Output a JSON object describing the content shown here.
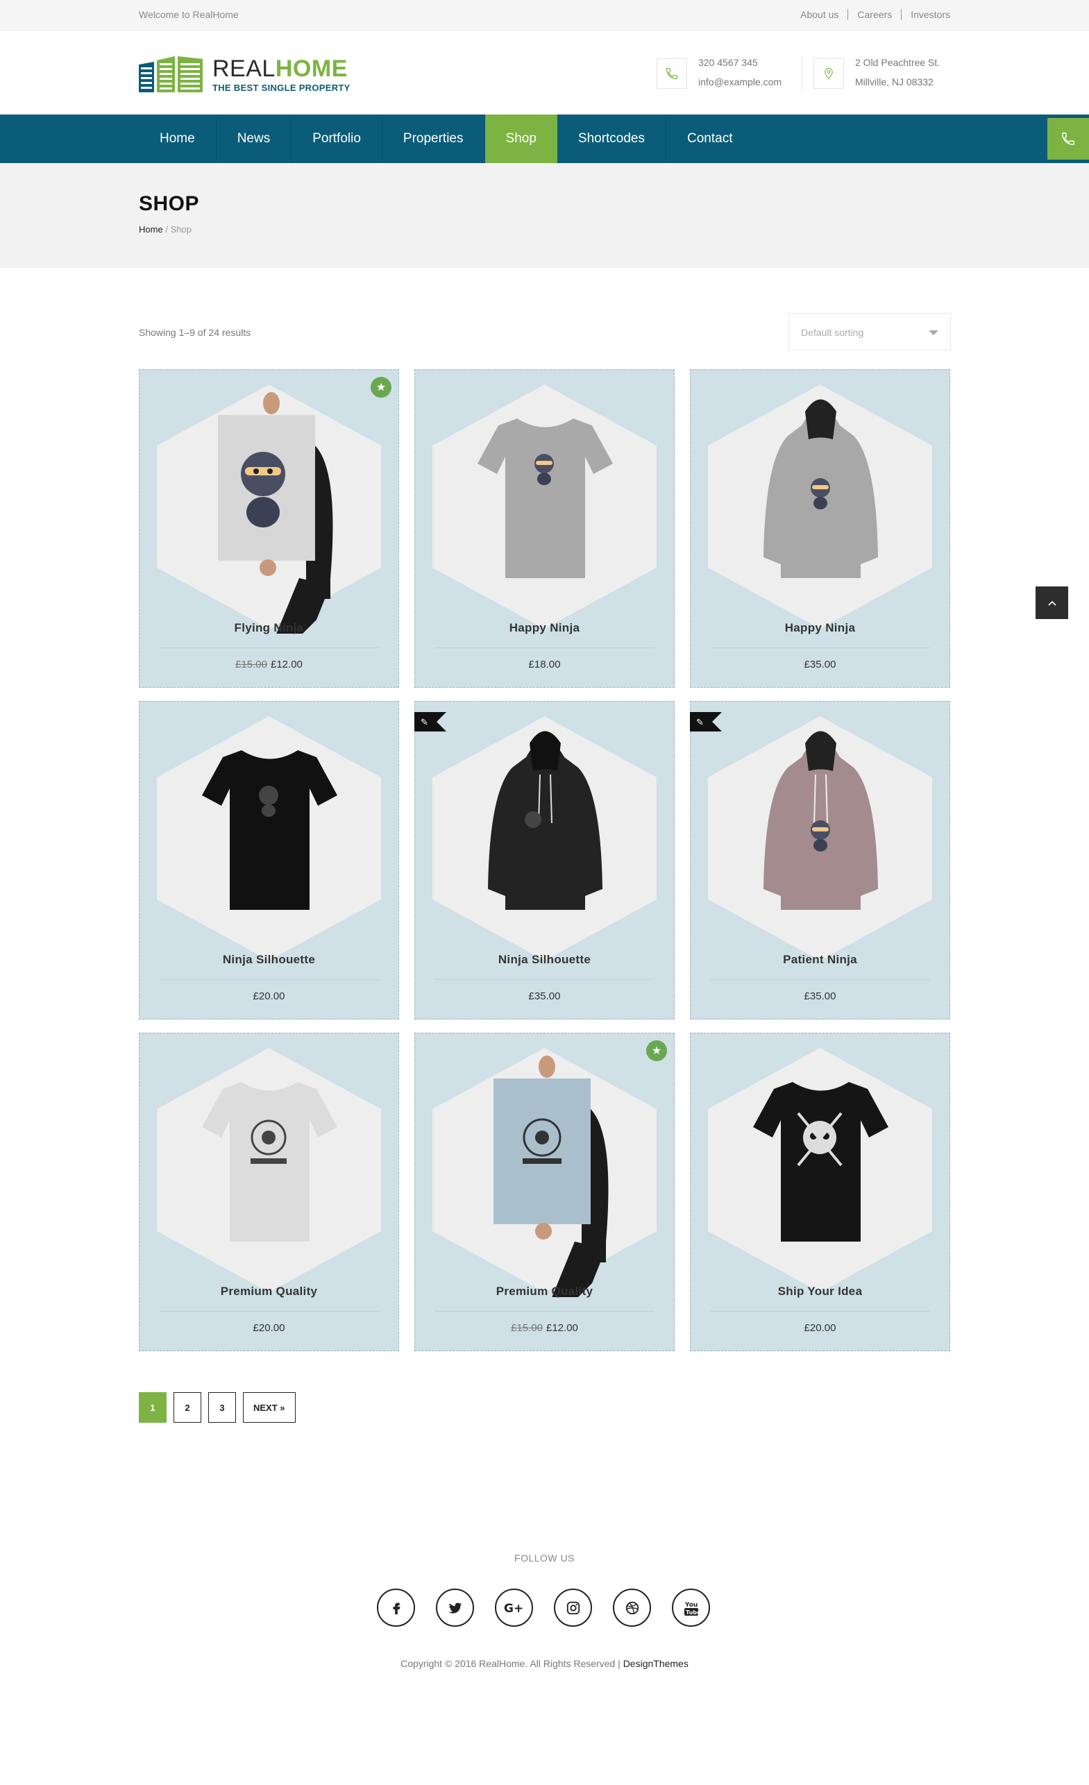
{
  "topbar": {
    "welcome": "Welcome to RealHome",
    "links": [
      "About us",
      "Careers",
      "Investors"
    ]
  },
  "header": {
    "logo_real": "REAL",
    "logo_home": "HOME",
    "tagline": "THE BEST SINGLE PROPERTY",
    "phone": "320 4567 345",
    "email": "info@example.com",
    "address_line1": "2 Old Peachtree St.",
    "address_line2": "Millville, NJ 08332"
  },
  "nav": {
    "items": [
      "Home",
      "News",
      "Portfolio",
      "Properties",
      "Shop",
      "Shortcodes",
      "Contact"
    ],
    "active": "Shop",
    "phone_icon": "phone-icon"
  },
  "page": {
    "title": "SHOP",
    "breadcrumb_home": "Home",
    "breadcrumb_sep": "/",
    "breadcrumb_current": "Shop"
  },
  "toolbar": {
    "results": "Showing 1–9 of 24 results",
    "sort_selected": "Default sorting"
  },
  "products": [
    {
      "name": "Flying Ninja",
      "old_price": "£15.00",
      "price": "£12.00",
      "badge": "featured",
      "image": "poster-ninja"
    },
    {
      "name": "Happy Ninja",
      "old_price": "",
      "price": "£18.00",
      "badge": "",
      "image": "grey-tshirt"
    },
    {
      "name": "Happy Ninja",
      "old_price": "",
      "price": "£35.00",
      "badge": "",
      "image": "grey-hoodie"
    },
    {
      "name": "Ninja Silhouette",
      "old_price": "",
      "price": "£20.00",
      "badge": "",
      "image": "black-tshirt"
    },
    {
      "name": "Ninja Silhouette",
      "old_price": "",
      "price": "£35.00",
      "badge": "pinned",
      "image": "black-hoodie"
    },
    {
      "name": "Patient Ninja",
      "old_price": "",
      "price": "£35.00",
      "badge": "pinned",
      "image": "pink-hoodie"
    },
    {
      "name": "Premium Quality",
      "old_price": "",
      "price": "£20.00",
      "badge": "",
      "image": "white-tshirt-woo"
    },
    {
      "name": "Premium Quality",
      "old_price": "£15.00",
      "price": "£12.00",
      "badge": "featured",
      "image": "poster-woo"
    },
    {
      "name": "Ship Your Idea",
      "old_price": "",
      "price": "£20.00",
      "badge": "",
      "image": "black-tshirt-skull"
    }
  ],
  "pagination": {
    "pages": [
      "1",
      "2",
      "3"
    ],
    "current": "1",
    "next": "NEXT »"
  },
  "footer": {
    "follow": "FOLLOW US",
    "social": [
      "facebook-icon",
      "twitter-icon",
      "google-plus-icon",
      "instagram-icon",
      "dribbble-icon",
      "youtube-icon"
    ],
    "copyright": "Copyright © 2016 RealHome. All Rights Reserved |",
    "brand": "DesignThemes"
  },
  "colors": {
    "primary": "#0b5c79",
    "accent": "#7cb342",
    "card_bg": "#cfe0e6"
  }
}
